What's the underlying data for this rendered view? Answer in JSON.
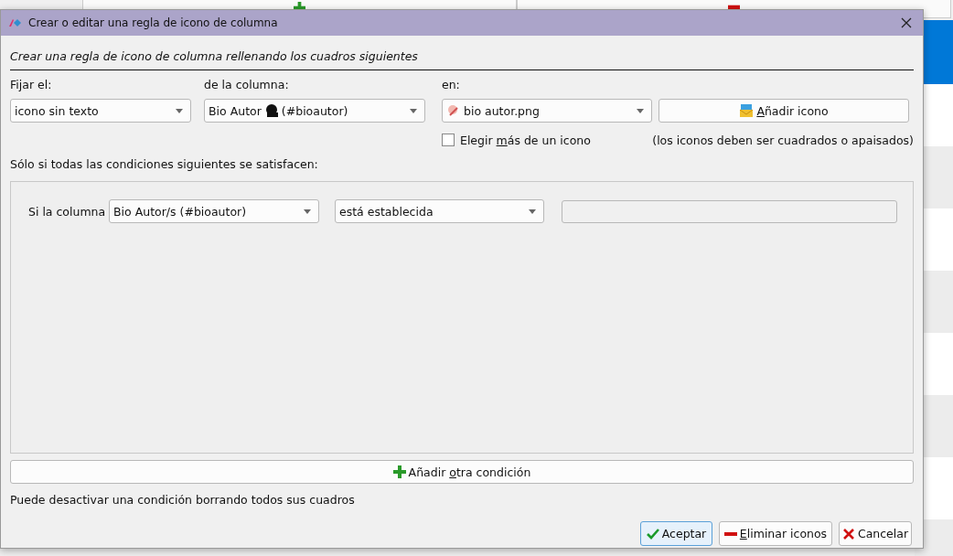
{
  "window": {
    "title": "Crear o editar una regla de icono de columna"
  },
  "heading": "Crear una regla de icono de columna rellenando los cuadros siguientes",
  "fields": [
    {
      "kind": "combo",
      "label": "Fijar el:",
      "value": "icono sin texto"
    },
    {
      "kind": "combo-blot",
      "label": "de la columna:",
      "value": "Bio Autor",
      "value_tail": "(#bioautor)"
    },
    {
      "kind": "combo-image",
      "label": "en:",
      "value": "bio autor.png"
    }
  ],
  "add_icon_button": {
    "accel": "A",
    "after": "ñadir icono"
  },
  "multi_icon": {
    "checked": false,
    "before": "Elegir ",
    "accel": "m",
    "after": "ás de un icono"
  },
  "icon_note": "(los iconos deben ser cuadrados o apaisados)",
  "conditions_label": "Sólo si todas las condiciones siguientes se satisfacen:",
  "conditions": [
    {
      "label": "Si la columna",
      "column": "Bio Autor/s (#bioautor)",
      "operator": "está establecida"
    }
  ],
  "add_condition_button": {
    "before": "Añadir ",
    "accel": "o",
    "after": "tra condición"
  },
  "hint": "Puede desactivar una condición borrando todos sus cuadros",
  "buttons": [
    {
      "kind": "ok",
      "after": "Aceptar"
    },
    {
      "kind": "remove",
      "accel": "E",
      "after": "liminar iconos"
    },
    {
      "kind": "cancel",
      "after": "Cancelar"
    }
  ]
}
